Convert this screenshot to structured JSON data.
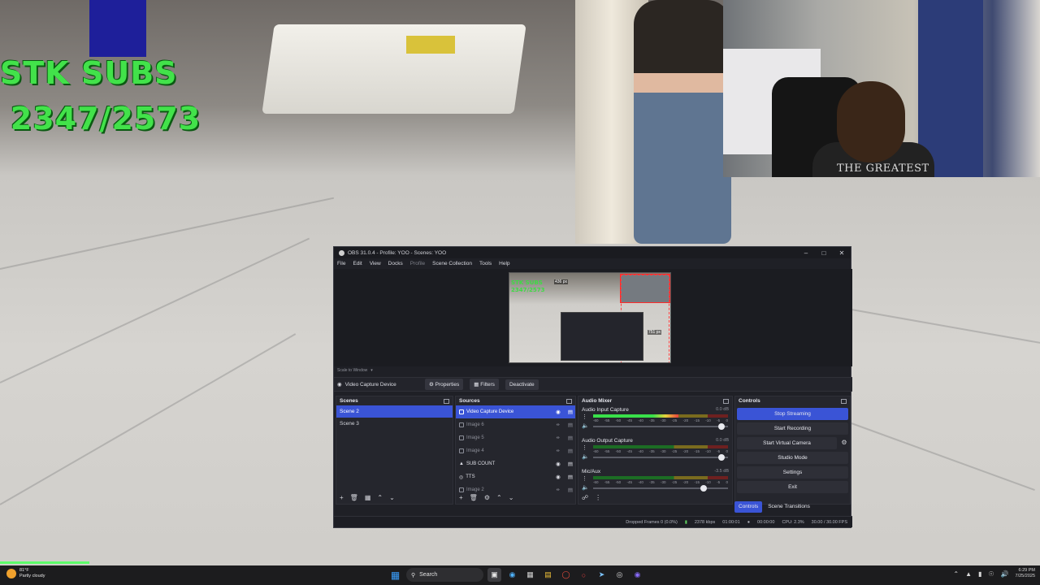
{
  "overlay": {
    "subs_line1": "STK SUBS",
    "subs_line2": "2347/2573",
    "webcam_shirt_text": "THE GREATEST"
  },
  "obs": {
    "title": "OBS 31.0.4 - Profile: YOO - Scenes: YOO",
    "menu": [
      "File",
      "Edit",
      "View",
      "Docks",
      "Profile",
      "Scene Collection",
      "Tools",
      "Help"
    ],
    "preview": {
      "subs_text_1": "STK SUBS",
      "subs_text_2": "2347/2573",
      "width_label": "436 px",
      "height_label": "751 px"
    },
    "scale_label": "Scale to Window",
    "context_bar": {
      "source_name": "Video Capture Device",
      "properties_label": "Properties",
      "filters_label": "Filters",
      "deactivate_label": "Deactivate"
    },
    "scenes": {
      "header": "Scenes",
      "items": [
        "Scene 2",
        "Scene 3"
      ],
      "selected": "Scene 2"
    },
    "sources": {
      "header": "Sources",
      "items": [
        "Video Capture Device",
        "Image 6",
        "Image 5",
        "Image 4",
        "SUB COUNT",
        "TTS",
        "Image 2"
      ]
    },
    "mixer": {
      "header": "Audio Mixer",
      "channels": [
        {
          "name": "Audio Input Capture",
          "db": "0.0 dB",
          "level": 0.63,
          "volume": 0.95
        },
        {
          "name": "Audio Output Capture",
          "db": "0.0 dB",
          "level": 0.0,
          "volume": 0.95
        },
        {
          "name": "Mic/Aux",
          "db": "-3.5 dB",
          "level": 0.0,
          "volume": 0.82
        }
      ],
      "ticks": [
        "-60",
        "-55",
        "-50",
        "-45",
        "-40",
        "-35",
        "-30",
        "-25",
        "-20",
        "-15",
        "-10",
        "-5",
        "0"
      ]
    },
    "controls": {
      "header": "Controls",
      "stop_streaming": "Stop Streaming",
      "start_recording": "Start Recording",
      "start_virtual_camera": "Start Virtual Camera",
      "studio_mode": "Studio Mode",
      "settings": "Settings",
      "exit": "Exit"
    },
    "tabs": {
      "controls": "Controls",
      "scene_transitions": "Scene Transitions"
    },
    "status": {
      "dropped_frames": "Dropped Frames 0 (0.0%)",
      "bitrate": "2378 kbps",
      "stream_time": "01:00:01",
      "rec_time": "00:00:00",
      "cpu": "CPU: 2.3%",
      "fps": "30.00 / 30.00 FPS"
    }
  },
  "taskbar": {
    "weather_temp": "81°F",
    "weather_desc": "Partly cloudy",
    "search_label": "Search",
    "time": "6:29 PM",
    "date": "7/25/2025"
  }
}
